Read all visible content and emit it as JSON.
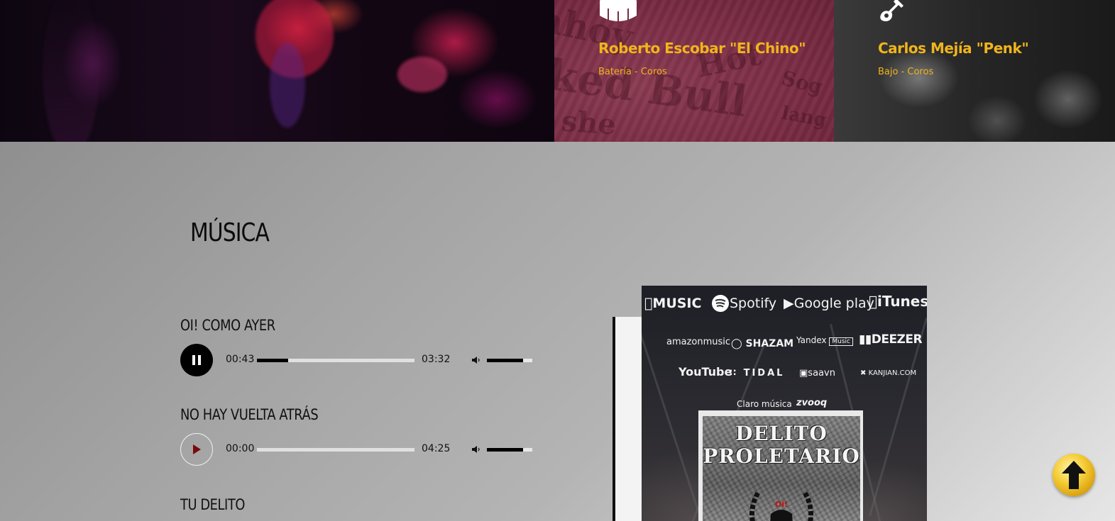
{
  "band_members": [
    {
      "name": "Roberto Escobar \"El Chino\"",
      "role": "Batería - Coros",
      "icon": "drum-icon"
    },
    {
      "name": "Carlos Mejía \"Penk\"",
      "role": "Bajo - Coros",
      "icon": "guitar-icon"
    }
  ],
  "colors": {
    "accent": "#f0b51c",
    "card_bg": "#7a2c44"
  },
  "music": {
    "title": "MÚSICA",
    "tracks": [
      {
        "title": "OI! COMO AYER",
        "current": "00:43",
        "duration": "03:32",
        "state": "playing",
        "progress": 0.2,
        "volume": 0.8
      },
      {
        "title": "NO HAY VUELTA ATRÁS",
        "current": "00:00",
        "duration": "04:25",
        "state": "paused",
        "progress": 0.0,
        "volume": 0.8
      },
      {
        "title": "TU DELITO"
      }
    ]
  },
  "album": {
    "platforms": [
      "MUSIC",
      "Spotify",
      "Google play",
      "iTunes",
      "amazonmusic",
      "SHAZAM",
      "Yandex",
      "Music",
      "DEEZER",
      "YouTube",
      "TIDAL",
      "saavn",
      "KANJIAN.COM",
      "Claro música",
      "zvooq"
    ],
    "cover_line1": "DELITO",
    "cover_line2": "PROLETARIO",
    "badge": "Oi!"
  },
  "scroll_top_icon": "arrow-up-icon"
}
